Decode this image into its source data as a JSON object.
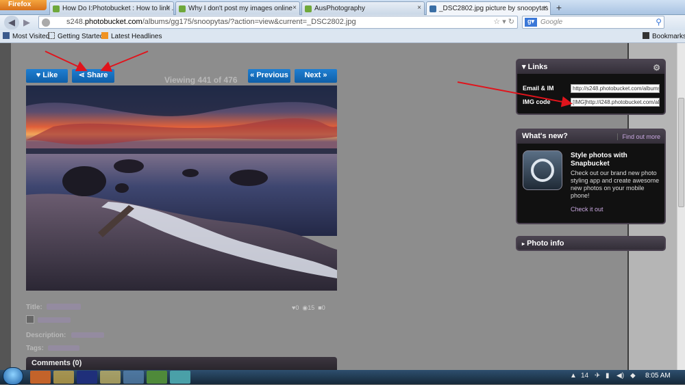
{
  "browser": {
    "menu_label": "Firefox",
    "tabs": [
      {
        "title": "How Do I:Photobucket : How to link ..."
      },
      {
        "title": "Why I don't post my images online"
      },
      {
        "title": "AusPhotography"
      },
      {
        "title": "_DSC2802.jpg picture by snoopytas - ..."
      }
    ],
    "new_tab_label": "+",
    "url_prefix": "s248.",
    "url_host": "photobucket.com",
    "url_path": "/albums/gg175/snoopytas/?action=view&current=_DSC2802.jpg",
    "search_engine": "Google",
    "search_placeholder": "Google",
    "bookmarks": {
      "most_visited": "Most Visited",
      "getting_started": "Getting Started",
      "latest_headlines": "Latest Headlines",
      "bookmarks_menu": "Bookmarks"
    }
  },
  "photo_page": {
    "like_label": "Like",
    "share_label": "Share",
    "viewing_text": "Viewing 441 of 476",
    "previous_label": "« Previous",
    "next_label": "Next »",
    "meta": {
      "title_label": "Title:",
      "description_label": "Description:",
      "tags_label": "Tags:"
    },
    "stats": {
      "likes": "0",
      "views": "15",
      "comments": "0"
    },
    "comments_header": "Comments (0)"
  },
  "links_panel": {
    "title": "Links",
    "email_label": "Email & IM",
    "email_value": "http://s248.photobucket.com/albums/",
    "img_label": "IMG code",
    "img_value": "[IMG]http://i248.photobucket.com/alb"
  },
  "whats_new_panel": {
    "title": "What's new?",
    "find_out_more": "Find out more",
    "headline": "Style photos with Snapbucket",
    "body": "Check out our brand new photo styling app and create awesome new photos on your mobile phone!",
    "cta": "Check it out"
  },
  "photo_info_panel": {
    "title": "Photo info"
  },
  "taskbar": {
    "clock": "8:05 AM",
    "tray_number": "14"
  },
  "colors": {
    "accent_blue": "#1670bf",
    "annotation_red": "#e0141c",
    "link_purple": "#a17ac7"
  }
}
